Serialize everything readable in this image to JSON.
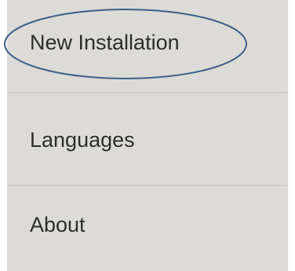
{
  "menu": {
    "items": [
      {
        "label": "New Installation",
        "highlighted": true
      },
      {
        "label": "Languages"
      },
      {
        "label": "About"
      }
    ]
  },
  "colors": {
    "menu_background": "#dcdbd8",
    "divider": "#cfcecb",
    "text": "#2d2d2d",
    "annotation_outline": "#3d5f8a"
  }
}
